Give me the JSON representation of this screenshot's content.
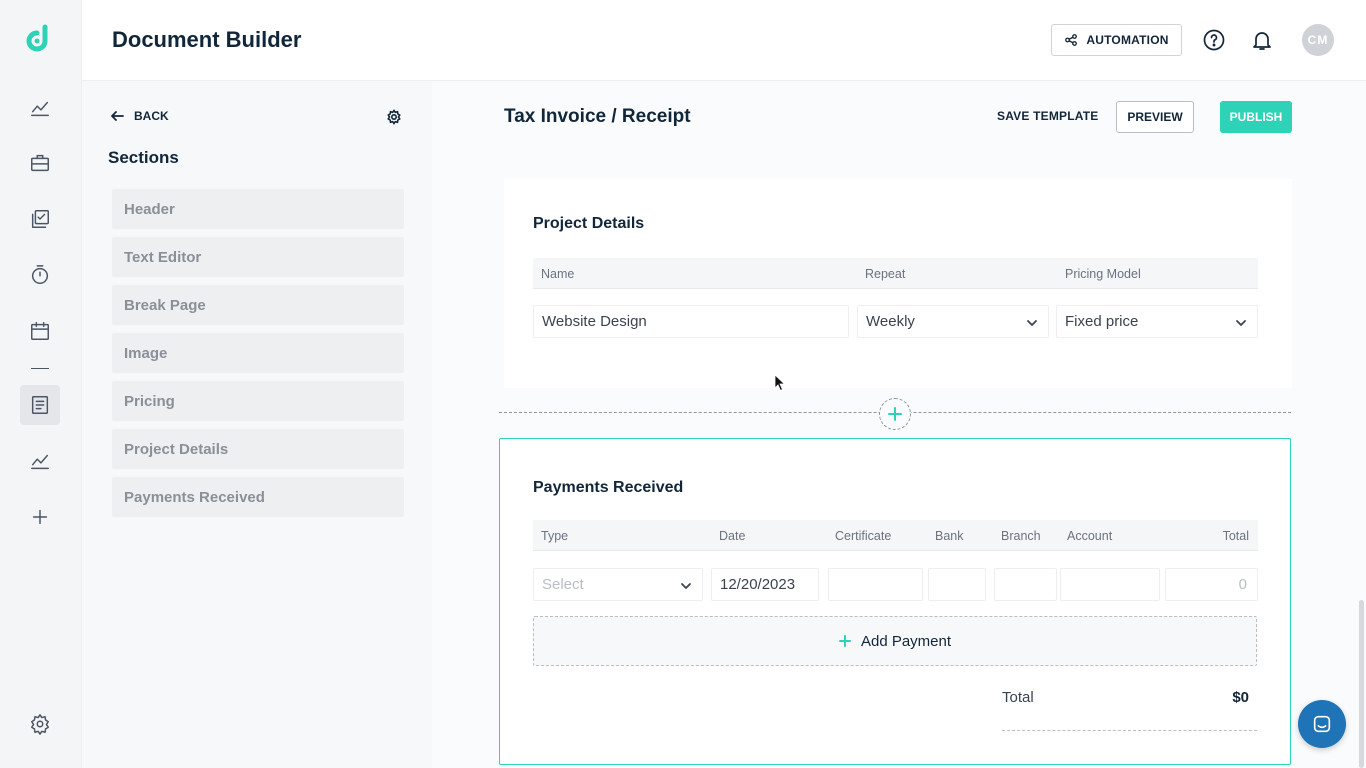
{
  "header": {
    "title": "Document Builder",
    "automation_label": "AUTOMATION",
    "avatar_initials": "CM"
  },
  "sidebar_rail": {
    "icons": [
      "logo-icon",
      "analytics-icon",
      "briefcase-icon",
      "tasks-icon",
      "timer-icon",
      "calendar-icon",
      "documents-icon",
      "reports-icon",
      "add-icon",
      "settings-icon"
    ],
    "active": "documents-icon"
  },
  "panel": {
    "back_label": "BACK",
    "sections_title": "Sections",
    "items": [
      {
        "label": "Header"
      },
      {
        "label": "Text Editor"
      },
      {
        "label": "Break Page"
      },
      {
        "label": "Image"
      },
      {
        "label": "Pricing"
      },
      {
        "label": "Project Details"
      },
      {
        "label": "Payments Received"
      }
    ]
  },
  "toolbar": {
    "doc_title": "Tax Invoice / Receipt",
    "save_template_label": "SAVE TEMPLATE",
    "preview_label": "PREVIEW",
    "publish_label": "PUBLISH"
  },
  "project_details": {
    "title": "Project Details",
    "columns": [
      "Name",
      "Repeat",
      "Pricing Model"
    ],
    "name_value": "Website Design",
    "repeat_value": "Weekly",
    "pricing_model_value": "Fixed price"
  },
  "payments": {
    "title": "Payments Received",
    "columns": [
      "Type",
      "Date",
      "Certificate",
      "Bank",
      "Branch",
      "Account",
      "Total"
    ],
    "type_placeholder": "Select",
    "date_value": "12/20/2023",
    "total_cell": "0",
    "add_payment_label": "Add Payment",
    "total_label": "Total",
    "total_value": "$0"
  },
  "colors": {
    "accent": "#2ed3b7",
    "text_dark": "#12263a",
    "chat": "#1f73b7"
  }
}
